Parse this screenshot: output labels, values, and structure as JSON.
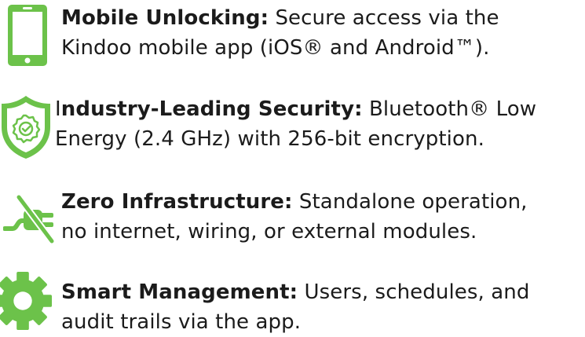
{
  "colors": {
    "accent": "#6cc24a",
    "text": "#1b1b1b"
  },
  "features": [
    {
      "icon": "smartphone-icon",
      "title": "Mobile Unlocking:",
      "line1": " Secure access via the",
      "line2": "Kindoo mobile app (iOS® and Android™)."
    },
    {
      "icon": "security-shield-icon",
      "title_prefix": "I",
      "title": "ndustry-Leading Security:",
      "line1": " Bluetooth® Low",
      "line2": "Energy (2.4 GHz) with 256-bit encryption."
    },
    {
      "icon": "unplugged-icon",
      "title": "Zero Infrastructure:",
      "line1": " Standalone operation,",
      "line2": "no internet, wiring, or external modules."
    },
    {
      "icon": "gear-icon",
      "title": "Smart Management:",
      "line1": " Users, schedules, and",
      "line2": "audit trails via the app."
    }
  ]
}
